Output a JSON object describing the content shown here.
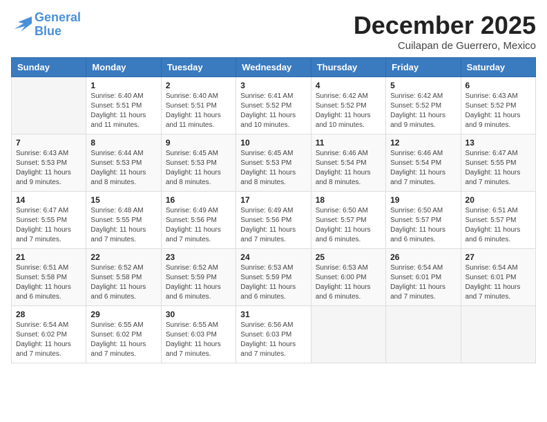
{
  "logo": {
    "line1": "General",
    "line2": "Blue"
  },
  "title": "December 2025",
  "subtitle": "Cuilapan de Guerrero, Mexico",
  "days_header": [
    "Sunday",
    "Monday",
    "Tuesday",
    "Wednesday",
    "Thursday",
    "Friday",
    "Saturday"
  ],
  "weeks": [
    [
      {
        "day": "",
        "info": ""
      },
      {
        "day": "1",
        "info": "Sunrise: 6:40 AM\nSunset: 5:51 PM\nDaylight: 11 hours\nand 11 minutes."
      },
      {
        "day": "2",
        "info": "Sunrise: 6:40 AM\nSunset: 5:51 PM\nDaylight: 11 hours\nand 11 minutes."
      },
      {
        "day": "3",
        "info": "Sunrise: 6:41 AM\nSunset: 5:52 PM\nDaylight: 11 hours\nand 10 minutes."
      },
      {
        "day": "4",
        "info": "Sunrise: 6:42 AM\nSunset: 5:52 PM\nDaylight: 11 hours\nand 10 minutes."
      },
      {
        "day": "5",
        "info": "Sunrise: 6:42 AM\nSunset: 5:52 PM\nDaylight: 11 hours\nand 9 minutes."
      },
      {
        "day": "6",
        "info": "Sunrise: 6:43 AM\nSunset: 5:52 PM\nDaylight: 11 hours\nand 9 minutes."
      }
    ],
    [
      {
        "day": "7",
        "info": "Sunrise: 6:43 AM\nSunset: 5:53 PM\nDaylight: 11 hours\nand 9 minutes."
      },
      {
        "day": "8",
        "info": "Sunrise: 6:44 AM\nSunset: 5:53 PM\nDaylight: 11 hours\nand 8 minutes."
      },
      {
        "day": "9",
        "info": "Sunrise: 6:45 AM\nSunset: 5:53 PM\nDaylight: 11 hours\nand 8 minutes."
      },
      {
        "day": "10",
        "info": "Sunrise: 6:45 AM\nSunset: 5:53 PM\nDaylight: 11 hours\nand 8 minutes."
      },
      {
        "day": "11",
        "info": "Sunrise: 6:46 AM\nSunset: 5:54 PM\nDaylight: 11 hours\nand 8 minutes."
      },
      {
        "day": "12",
        "info": "Sunrise: 6:46 AM\nSunset: 5:54 PM\nDaylight: 11 hours\nand 7 minutes."
      },
      {
        "day": "13",
        "info": "Sunrise: 6:47 AM\nSunset: 5:55 PM\nDaylight: 11 hours\nand 7 minutes."
      }
    ],
    [
      {
        "day": "14",
        "info": "Sunrise: 6:47 AM\nSunset: 5:55 PM\nDaylight: 11 hours\nand 7 minutes."
      },
      {
        "day": "15",
        "info": "Sunrise: 6:48 AM\nSunset: 5:55 PM\nDaylight: 11 hours\nand 7 minutes."
      },
      {
        "day": "16",
        "info": "Sunrise: 6:49 AM\nSunset: 5:56 PM\nDaylight: 11 hours\nand 7 minutes."
      },
      {
        "day": "17",
        "info": "Sunrise: 6:49 AM\nSunset: 5:56 PM\nDaylight: 11 hours\nand 7 minutes."
      },
      {
        "day": "18",
        "info": "Sunrise: 6:50 AM\nSunset: 5:57 PM\nDaylight: 11 hours\nand 6 minutes."
      },
      {
        "day": "19",
        "info": "Sunrise: 6:50 AM\nSunset: 5:57 PM\nDaylight: 11 hours\nand 6 minutes."
      },
      {
        "day": "20",
        "info": "Sunrise: 6:51 AM\nSunset: 5:57 PM\nDaylight: 11 hours\nand 6 minutes."
      }
    ],
    [
      {
        "day": "21",
        "info": "Sunrise: 6:51 AM\nSunset: 5:58 PM\nDaylight: 11 hours\nand 6 minutes."
      },
      {
        "day": "22",
        "info": "Sunrise: 6:52 AM\nSunset: 5:58 PM\nDaylight: 11 hours\nand 6 minutes."
      },
      {
        "day": "23",
        "info": "Sunrise: 6:52 AM\nSunset: 5:59 PM\nDaylight: 11 hours\nand 6 minutes."
      },
      {
        "day": "24",
        "info": "Sunrise: 6:53 AM\nSunset: 5:59 PM\nDaylight: 11 hours\nand 6 minutes."
      },
      {
        "day": "25",
        "info": "Sunrise: 6:53 AM\nSunset: 6:00 PM\nDaylight: 11 hours\nand 6 minutes."
      },
      {
        "day": "26",
        "info": "Sunrise: 6:54 AM\nSunset: 6:01 PM\nDaylight: 11 hours\nand 7 minutes."
      },
      {
        "day": "27",
        "info": "Sunrise: 6:54 AM\nSunset: 6:01 PM\nDaylight: 11 hours\nand 7 minutes."
      }
    ],
    [
      {
        "day": "28",
        "info": "Sunrise: 6:54 AM\nSunset: 6:02 PM\nDaylight: 11 hours\nand 7 minutes."
      },
      {
        "day": "29",
        "info": "Sunrise: 6:55 AM\nSunset: 6:02 PM\nDaylight: 11 hours\nand 7 minutes."
      },
      {
        "day": "30",
        "info": "Sunrise: 6:55 AM\nSunset: 6:03 PM\nDaylight: 11 hours\nand 7 minutes."
      },
      {
        "day": "31",
        "info": "Sunrise: 6:56 AM\nSunset: 6:03 PM\nDaylight: 11 hours\nand 7 minutes."
      },
      {
        "day": "",
        "info": ""
      },
      {
        "day": "",
        "info": ""
      },
      {
        "day": "",
        "info": ""
      }
    ]
  ]
}
